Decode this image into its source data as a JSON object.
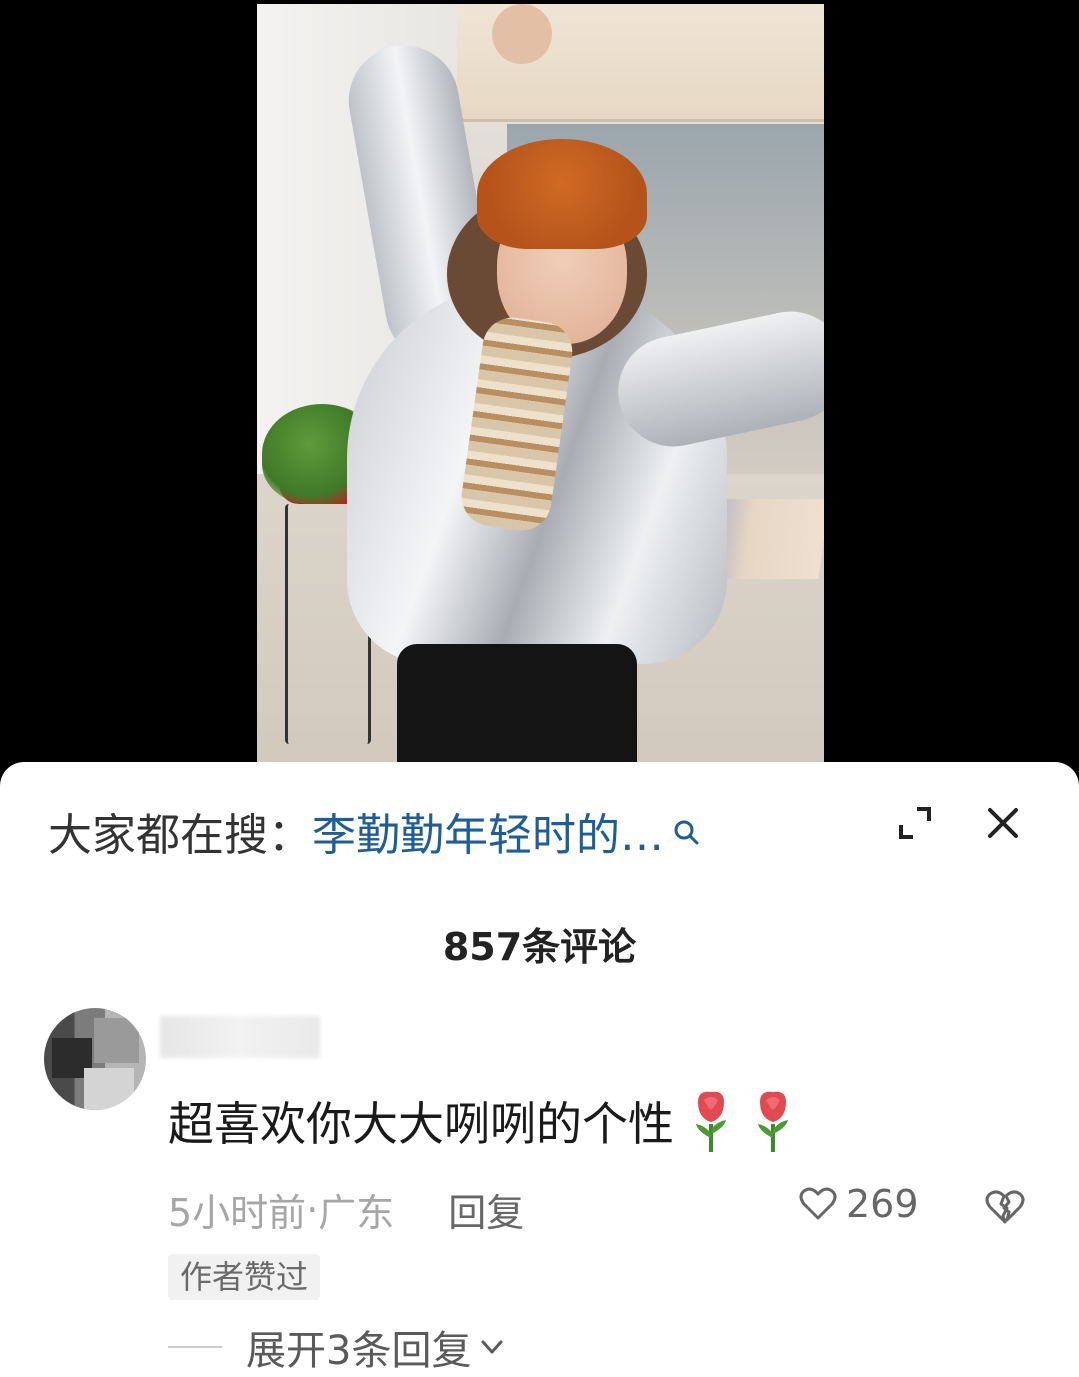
{
  "search": {
    "prefix": "大家都在搜：",
    "term": "李勤勤年轻时的…"
  },
  "comments_header": {
    "count_label": "857条评论"
  },
  "comment": {
    "text": "超喜欢你大大咧咧的个性",
    "emoji": [
      "rose-icon",
      "rose-icon"
    ],
    "time": "5小时前",
    "separator": " · ",
    "location": "广东",
    "reply_label": "回复",
    "like_count": "269",
    "author_badge": "作者赞过",
    "expand_replies_label": "展开3条回复"
  },
  "colors": {
    "search_term": "#1e5d99",
    "sheet_background": "#ffffff",
    "page_background": "#000000"
  }
}
